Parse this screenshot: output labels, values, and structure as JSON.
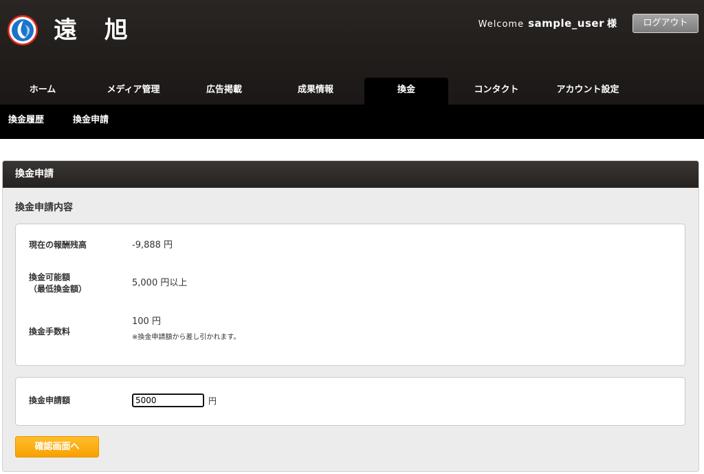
{
  "header": {
    "brand": "遠 旭",
    "welcome_label": "Welcome",
    "username": "sample_user",
    "honorific": "様",
    "logout_label": "ログアウト"
  },
  "nav": {
    "tabs": [
      {
        "label": "ホーム"
      },
      {
        "label": "メディア管理"
      },
      {
        "label": "広告掲載"
      },
      {
        "label": "成果情報"
      },
      {
        "label": "換金",
        "active": true
      },
      {
        "label": "コンタクト"
      },
      {
        "label": "アカウント設定"
      }
    ]
  },
  "subnav": {
    "items": [
      {
        "label": "換金履歴"
      },
      {
        "label": "換金申請"
      }
    ]
  },
  "panel": {
    "title": "換金申請",
    "section_title": "換金申請内容",
    "balance": {
      "label": "現在の報酬残高",
      "value": "-9,888 円"
    },
    "minimum": {
      "label_line1": "換金可能額",
      "label_line2": "（最低換金額）",
      "value": "5,000 円以上"
    },
    "fee": {
      "label": "換金手数料",
      "value": "100 円",
      "note": "※換金申請額から差し引かれます。"
    },
    "request": {
      "label": "換金申請額",
      "input_value": "5000",
      "unit": "円"
    },
    "confirm_label": "確認画面へ"
  },
  "colors": {
    "header_bg": "#231f1e",
    "subnav_bg": "#000000",
    "panel_bg": "#ececec",
    "button_accent": "#f8a100"
  }
}
